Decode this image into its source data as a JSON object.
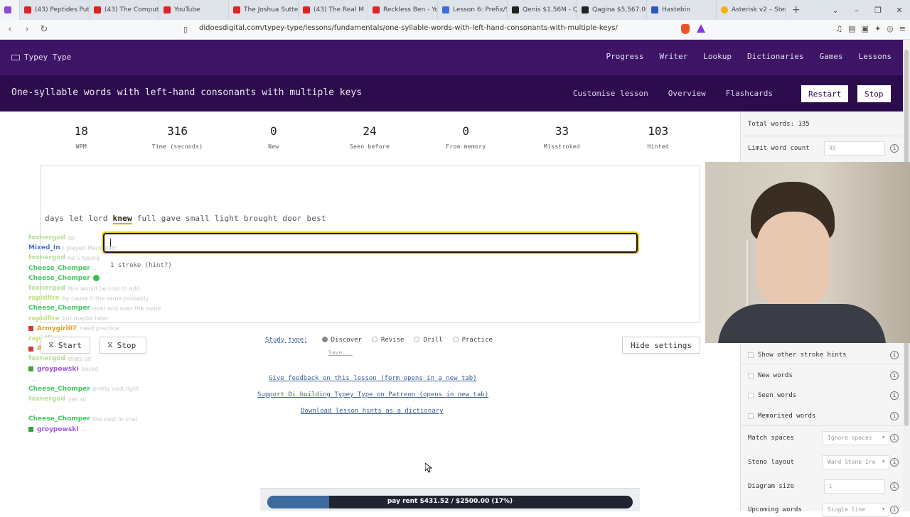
{
  "browser": {
    "tabs": [
      {
        "title": "(43) Peptides Put",
        "icon": "youtube-icon"
      },
      {
        "title": "(43) The Computer",
        "icon": "youtube-icon"
      },
      {
        "title": "YouTube",
        "icon": "youtube-icon"
      },
      {
        "title": "The Joshua Sutter",
        "icon": "youtube-icon"
      },
      {
        "title": "(43) The Real M",
        "icon": "youtube-icon"
      },
      {
        "title": "Reckless Ben - You",
        "icon": "youtube-icon"
      },
      {
        "title": "Lesson 6: Prefix/Su",
        "icon": "doc-icon"
      },
      {
        "title": "Qenis $1.56M - Qe",
        "icon": "github-icon"
      },
      {
        "title": "Qagina $5,567.00",
        "icon": "github-icon"
      },
      {
        "title": "Hastebin",
        "icon": "hastebin-icon"
      },
      {
        "title": "Asterisk v2 – Steno",
        "icon": "asterisk-icon"
      }
    ],
    "url": "didoesdigital.com/typey-type/lessons/fundamentals/one-syllable-words-with-left-hand-consonants-with-multiple-keys/"
  },
  "app": {
    "brand": "Typey Type",
    "nav": [
      "Progress",
      "Writer",
      "Lookup",
      "Dictionaries",
      "Games",
      "Lessons"
    ],
    "lesson_title": "One-syllable words with left-hand consonants with multiple keys",
    "lesson_links": [
      "Customise lesson",
      "Overview",
      "Flashcards"
    ],
    "restart_label": "Restart",
    "stop_label": "Stop"
  },
  "stats": [
    {
      "value": "18",
      "label": "WPM"
    },
    {
      "value": "316",
      "label": "Time (seconds)"
    },
    {
      "value": "0",
      "label": "New"
    },
    {
      "value": "24",
      "label": "Seen before"
    },
    {
      "value": "0",
      "label": "From memory"
    },
    {
      "value": "33",
      "label": "Misstroked"
    },
    {
      "value": "103",
      "label": "Hinted"
    }
  ],
  "typing": {
    "completed_words": "days let lord",
    "current_word": "knew",
    "upcoming_words": "full gave small light brought door best",
    "hint": "1 stroke (hint?)",
    "input_value": ""
  },
  "chat": [
    {
      "user": "foxnergod",
      "class": "u-foo",
      "msg": "lol"
    },
    {
      "user": "Mixed_In",
      "class": "u-mix",
      "msg": "I played Mario kart"
    },
    {
      "user": "foxnergod",
      "class": "u-foo",
      "msg": "he's typing"
    },
    {
      "user": "Cheese_Chomper",
      "class": "u-chz",
      "msg": "..."
    },
    {
      "user": "Cheese_Chomper",
      "class": "u-chz",
      "msg": "",
      "emote": true
    },
    {
      "user": "foxnergod",
      "class": "u-foo",
      "msg": "this would be cool to add"
    },
    {
      "user": "rapidfire",
      "class": "u-rap",
      "msg": "by cause it the same probably"
    },
    {
      "user": "Cheese_Chomper",
      "class": "u-chz",
      "msg": "over and over the same"
    },
    {
      "user": "rapidfire",
      "class": "u-rap",
      "msg": "but maybe later"
    },
    {
      "user": "Armygirl07",
      "class": "u-arm",
      "msg": "need practice",
      "badge": true
    },
    {
      "user": "rapidfire",
      "class": "u-rap",
      "msg": "I see"
    },
    {
      "user": "Armygirl07",
      "class": "u-arm",
      "msg": "",
      "badge": true
    },
    {
      "user": "foxnergod",
      "class": "u-foo",
      "msg": "thats all"
    },
    {
      "user": "groypowski",
      "class": "u-groy",
      "msg": "based",
      "badge_g": true
    },
    {
      "user": "",
      "class": "u-foo",
      "msg": "..."
    },
    {
      "user": "Cheese_Chomper",
      "class": "u-chz",
      "msg": "pretty cool right"
    },
    {
      "user": "foxnergod",
      "class": "u-foo",
      "msg": "yes sir"
    },
    {
      "user": "",
      "class": "u-foo",
      "msg": "..."
    },
    {
      "user": "Cheese_Chomper",
      "class": "u-chz",
      "msg": "the best in chat"
    },
    {
      "user": "groypowski",
      "class": "u-groy",
      "msg": "...",
      "badge_g": true
    }
  ],
  "controls": {
    "start_label": "Start",
    "stop_label": "Stop",
    "hide_settings_label": "Hide settings",
    "study_type_label": "Study type:",
    "study_types": [
      "Discover",
      "Revise",
      "Drill",
      "Practice"
    ],
    "study_selected": "Discover",
    "save_label": "Save..."
  },
  "footer_links": [
    "Give feedback on this lesson (form opens in a new tab)",
    "Support Di building Typey Type on Patreon (opens in new tab)",
    "Download lesson hints as a dictionary"
  ],
  "settings": {
    "total_words": "Total words: 135",
    "limit_word_count_label": "Limit word count",
    "limit_word_count_value": "45",
    "show_other_stroke_hints": "Show other stroke hints",
    "new_words": "New words",
    "seen_words": "Seen words",
    "memorised_words": "Memorised words",
    "match_spaces_label": "Match spaces",
    "match_spaces_value": "Ignore spaces",
    "steno_layout_label": "Steno layout",
    "steno_layout_value": "Ward Stone Ire",
    "diagram_size_label": "Diagram size",
    "diagram_size_value": "1",
    "upcoming_words_label": "Upcoming words",
    "upcoming_words_value": "Single line"
  },
  "donation": {
    "text": "pay rent $431.52 / $2500.00 (17%)",
    "progress_fraction": 0.17
  },
  "colors": {
    "header": "#3d1466",
    "lesson_bar": "#2c0c4d",
    "accent_yellow": "#e4c60a"
  }
}
